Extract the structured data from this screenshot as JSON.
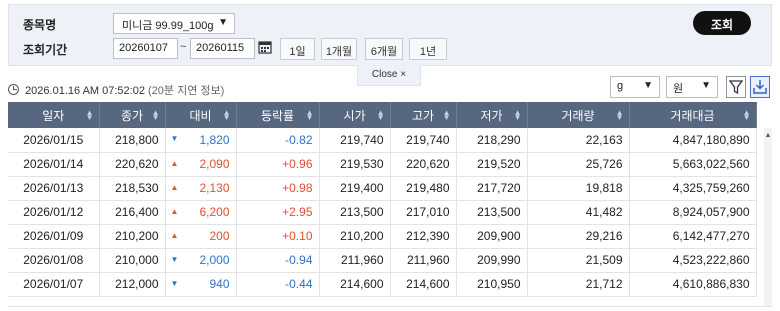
{
  "search": {
    "product_label": "종목명",
    "period_label": "조회기간",
    "product_value": "미니금 99.99_100g",
    "date_start": "20260107",
    "date_end": "20260115",
    "date_separator": "~",
    "period_buttons": [
      "1일",
      "1개월",
      "6개월",
      "1년"
    ],
    "lookup_label": "조회",
    "close_label": "Close ×"
  },
  "info": {
    "timestamp": "2026.01.16 AM 07:52:02",
    "delay_note": "(20분 지연 정보)",
    "unit_value": "g",
    "currency_value": "원"
  },
  "colors": {
    "header_bg": "#57677f",
    "up": "#e0502f",
    "down": "#2f73c6",
    "lookup_bg": "#111111"
  },
  "table": {
    "columns": [
      "일자",
      "종가",
      "대비",
      "등락률",
      "시가",
      "고가",
      "저가",
      "거래량",
      "거래대금"
    ],
    "rows": [
      {
        "date": "2026/01/15",
        "close": "218,800",
        "dir": "down",
        "arrow": "▼",
        "diff": "1,820",
        "rate": "-0.82",
        "open": "219,740",
        "high": "219,740",
        "low": "218,290",
        "volume": "22,163",
        "amount": "4,847,180,890"
      },
      {
        "date": "2026/01/14",
        "close": "220,620",
        "dir": "up",
        "arrow": "▲",
        "diff": "2,090",
        "rate": "+0.96",
        "open": "219,530",
        "high": "220,620",
        "low": "219,520",
        "volume": "25,726",
        "amount": "5,663,022,560"
      },
      {
        "date": "2026/01/13",
        "close": "218,530",
        "dir": "up",
        "arrow": "▲",
        "diff": "2,130",
        "rate": "+0.98",
        "open": "219,400",
        "high": "219,480",
        "low": "217,720",
        "volume": "19,818",
        "amount": "4,325,759,260"
      },
      {
        "date": "2026/01/12",
        "close": "216,400",
        "dir": "up",
        "arrow": "▲",
        "diff": "6,200",
        "rate": "+2.95",
        "open": "213,500",
        "high": "217,010",
        "low": "213,500",
        "volume": "41,482",
        "amount": "8,924,057,900"
      },
      {
        "date": "2026/01/09",
        "close": "210,200",
        "dir": "up",
        "arrow": "▲",
        "diff": "200",
        "rate": "+0.10",
        "open": "210,200",
        "high": "212,390",
        "low": "209,900",
        "volume": "29,216",
        "amount": "6,142,477,270"
      },
      {
        "date": "2026/01/08",
        "close": "210,000",
        "dir": "down",
        "arrow": "▼",
        "diff": "2,000",
        "rate": "-0.94",
        "open": "211,960",
        "high": "211,960",
        "low": "209,990",
        "volume": "21,509",
        "amount": "4,523,222,860"
      },
      {
        "date": "2026/01/07",
        "close": "212,000",
        "dir": "down",
        "arrow": "▼",
        "diff": "940",
        "rate": "-0.44",
        "open": "214,600",
        "high": "214,600",
        "low": "210,950",
        "volume": "21,712",
        "amount": "4,610,886,830"
      }
    ]
  }
}
